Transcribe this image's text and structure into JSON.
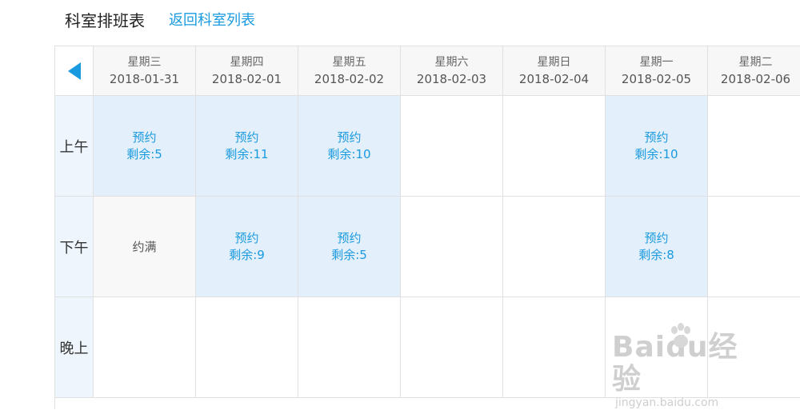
{
  "header": {
    "title": "科室排班表",
    "back_link": "返回科室列表"
  },
  "columns": [
    {
      "weekday": "星期三",
      "date": "2018-01-31"
    },
    {
      "weekday": "星期四",
      "date": "2018-02-01"
    },
    {
      "weekday": "星期五",
      "date": "2018-02-02"
    },
    {
      "weekday": "星期六",
      "date": "2018-02-03"
    },
    {
      "weekday": "星期日",
      "date": "2018-02-04"
    },
    {
      "weekday": "星期一",
      "date": "2018-02-05"
    },
    {
      "weekday": "星期二",
      "date": "2018-02-06"
    }
  ],
  "periods": [
    "上午",
    "下午",
    "晚上"
  ],
  "slots": {
    "morning": [
      {
        "label": "预约",
        "remain": "剩余:5"
      },
      {
        "label": "预约",
        "remain": "剩余:11"
      },
      {
        "label": "预约",
        "remain": "剩余:10"
      },
      null,
      null,
      {
        "label": "预约",
        "remain": "剩余:10"
      },
      null
    ],
    "afternoon": [
      {
        "full": "约满"
      },
      {
        "label": "预约",
        "remain": "剩余:9"
      },
      {
        "label": "预约",
        "remain": "剩余:5"
      },
      null,
      null,
      {
        "label": "预约",
        "remain": "剩余:8"
      },
      null
    ]
  },
  "watermark": {
    "main": "Baidu经验",
    "sub": "jingyan.baidu.com"
  },
  "colors": {
    "accent": "#1a9be0",
    "available_bg": "#e3effb",
    "period_bg": "#eef5fd"
  },
  "icons": {
    "prev": "triangle-left-icon"
  }
}
